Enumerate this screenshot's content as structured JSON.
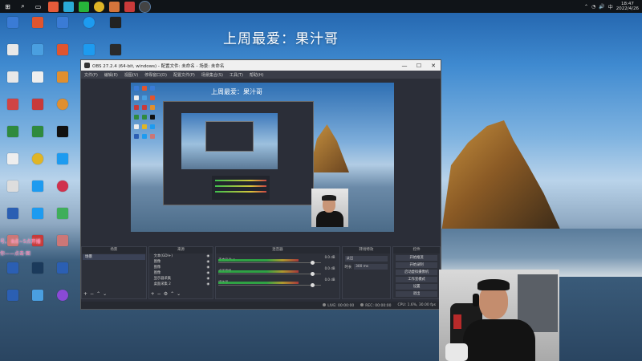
{
  "taskbar": {
    "items": [
      {
        "name": "start",
        "color": "#ffffff"
      },
      {
        "name": "search",
        "color": "#ffffff"
      },
      {
        "name": "task-view",
        "color": "#ffffff"
      },
      {
        "name": "app1",
        "color": "#e65b3a"
      },
      {
        "name": "app2",
        "color": "#2aa9d6"
      },
      {
        "name": "wechat",
        "color": "#27b33a"
      },
      {
        "name": "chrome",
        "color": "#e0b526"
      },
      {
        "name": "app3",
        "color": "#d5743b"
      },
      {
        "name": "app4",
        "color": "#7a3bd1"
      },
      {
        "name": "obs",
        "color": "#6d6d6d"
      }
    ],
    "time": "18:47",
    "date": "2022/4/26"
  },
  "wallpaper": {
    "title": "上周最爱：果汁哥"
  },
  "obs": {
    "title": "OBS 27.2.4 (64-bit, windows) - 配置文件: 未命名 - 场景: 未命名",
    "menu": [
      "文件(F)",
      "编辑(E)",
      "视图(V)",
      "停靠窗口(D)",
      "配置文件(P)",
      "场景集合(S)",
      "工具(T)",
      "帮助(H)"
    ],
    "preview_title": "上周最爱：果汁哥",
    "docks": {
      "scenes_header": "场景",
      "sources_header": "来源",
      "mixer_header": "混音器",
      "transitions_header": "转场特效",
      "controls_header": "控件"
    },
    "scenes": [
      "场景"
    ],
    "sources": [
      "桌面采集 2",
      "显示器采集",
      "图像",
      "图像",
      "图像",
      "图像",
      "文本(GDI+)"
    ],
    "mixer": [
      {
        "name": "麦克风/Aux",
        "db": "0.0 dB"
      },
      {
        "name": "桌面音频",
        "db": "0.0 dB"
      },
      {
        "name": "媒体源",
        "db": "0.0 dB"
      }
    ],
    "transition": {
      "type": "淡出",
      "duration_label": "时长",
      "duration": "300 ms"
    },
    "controls": [
      "开始推流",
      "开始录制",
      "启动虚拟摄像机",
      "工作室模式",
      "设置",
      "退出"
    ],
    "status": {
      "live": "LIVE: 00:00:00",
      "rec": "REC: 00:00:00",
      "cpu": "CPU: 1.6%, 30.00 fps"
    }
  },
  "danmaku": [
    "号。 8点~5点开播",
    "你——点击·图"
  ]
}
